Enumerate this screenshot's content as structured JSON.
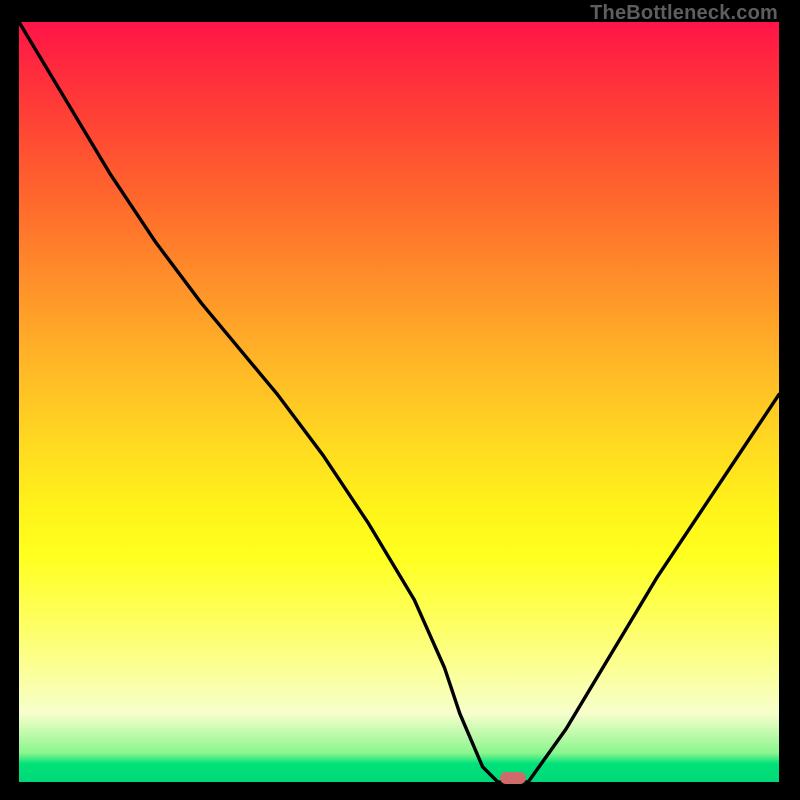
{
  "watermark": {
    "text": "TheBottleneck.com"
  },
  "colors": {
    "marker": "#cf6b6b",
    "curve": "#000000"
  },
  "chart_data": {
    "type": "line",
    "title": "",
    "xlabel": "",
    "ylabel": "",
    "xlim": [
      0,
      100
    ],
    "ylim": [
      0,
      100
    ],
    "grid": false,
    "legend_position": "none",
    "series": [
      {
        "name": "bottleneck-curve",
        "x": [
          0,
          6,
          12,
          18,
          24,
          29,
          34,
          40,
          46,
          52,
          56,
          58,
          61,
          63,
          67,
          72,
          78,
          84,
          90,
          96,
          100
        ],
        "y": [
          100,
          90,
          80,
          71,
          63,
          57,
          51,
          43,
          34,
          24,
          15,
          9,
          2,
          0,
          0,
          7,
          17,
          27,
          36,
          45,
          51
        ]
      }
    ],
    "annotations": [
      {
        "name": "optimal-marker",
        "x": 65,
        "y": 0.5
      }
    ]
  }
}
